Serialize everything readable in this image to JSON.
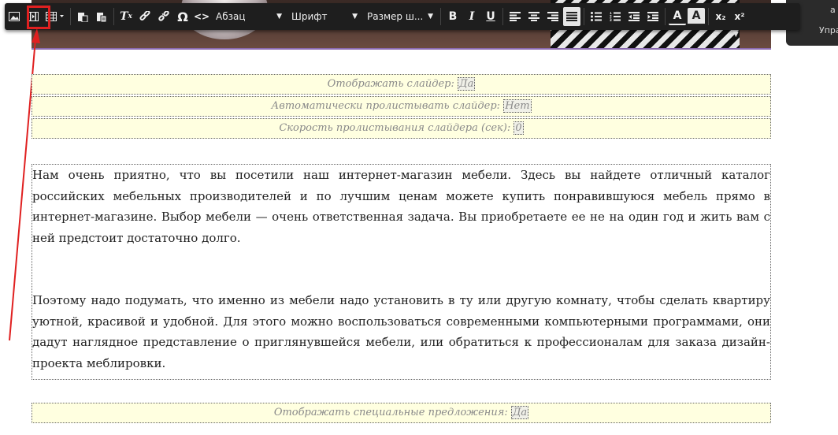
{
  "toolbar": {
    "paragraph_label": "Абзац",
    "font_label": "Шрифт",
    "size_label": "Размер ш...",
    "buttons": {
      "omega": "Ω",
      "code": "<>",
      "bold": "B",
      "italic": "I",
      "underline": "U",
      "text_color": "A",
      "bg_color": "A",
      "subscript": "x₂",
      "superscript": "x²"
    }
  },
  "right_panel": {
    "label_top": "а",
    "label": "Упра"
  },
  "settings": [
    {
      "label": "Отображать слайдер:",
      "value": "Да"
    },
    {
      "label": "Автоматически пролистывать слайдер:",
      "value": "Нет"
    },
    {
      "label": "Скорость пролистывания слайдера (сек):",
      "value": "0"
    }
  ],
  "content": {
    "paragraph1": "Нам очень приятно, что вы посетили наш интернет-магазин мебели. Здесь вы найдете отличный каталог российских мебельных производителей и по лучшим ценам можете купить понравившуюся мебель прямо в интернет-магазине. Выбор мебели — очень ответственная задача. Вы приобретаете ее не на один год и жить вам с ней предстоит достаточно долго.",
    "paragraph2": "Поэтому надо подумать, что именно из мебели надо установить в ту или другую комнату, чтобы сделать квартиру уютной, красивой и удобной. Для этого можно воспользоваться современными компьютерными программами, они дадут наглядное представление о приглянувшейся мебели, или обратиться к профессионалам для заказа дизайн-проекта меблировки."
  },
  "special": {
    "label": "Отображать специальные предложения:",
    "value": "Да"
  },
  "colors": {
    "toolbar_bg": "#1e1e1e",
    "setting_bg": "#ffffe0",
    "highlight": "#e02020"
  },
  "icons": [
    "image-icon",
    "media-icon",
    "table-icon",
    "paste-icon",
    "paste-text-icon",
    "clear-format-icon",
    "link-icon",
    "unlink-icon",
    "special-char-icon",
    "source-code-icon",
    "align-left-icon",
    "align-center-icon",
    "align-right-icon",
    "align-justify-icon",
    "bullet-list-icon",
    "numbered-list-icon",
    "outdent-icon",
    "indent-icon"
  ]
}
